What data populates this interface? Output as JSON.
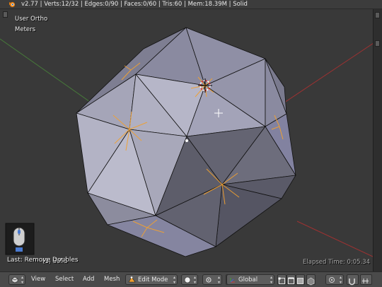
{
  "info_bar": {
    "stats": "v2.77 | Verts:12/32 | Edges:0/90 | Faces:0/60 | Tris:60 | Mem:18.39M | Solid"
  },
  "viewport": {
    "view_name": "User Ortho",
    "units": "Meters",
    "object_label": "(1) Solid",
    "elapsed": "Elapsed Time: 0:05.34",
    "last_operator": "Last: Remove Doubles"
  },
  "header": {
    "menu": [
      "View",
      "Select",
      "Add",
      "Mesh"
    ],
    "mode": "Edit Mode",
    "orientation": "Global"
  },
  "colors": {
    "background": "#393939",
    "face_light": "#9b9bb0",
    "face_dark": "#5a5a68",
    "selected_edge": "#f0a030",
    "x_axis": "#b03030",
    "y_axis": "#4a8a3a"
  }
}
